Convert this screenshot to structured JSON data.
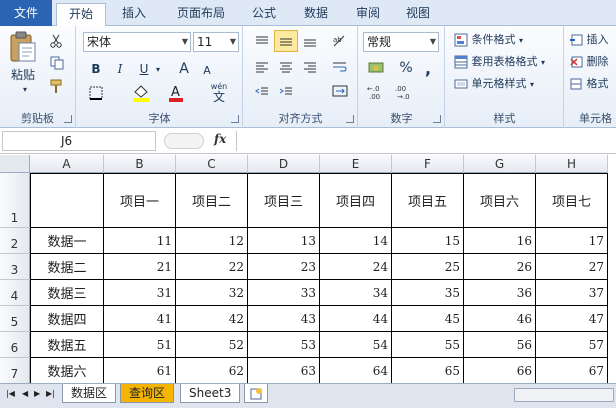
{
  "ribbon_tabs": [
    "文件",
    "开始",
    "插入",
    "页面布局",
    "公式",
    "数据",
    "审阅",
    "视图"
  ],
  "active_tab": "开始",
  "groups": {
    "clipboard": {
      "label": "剪贴板",
      "paste": "粘贴"
    },
    "font": {
      "label": "字体",
      "name": "宋体",
      "size": "11",
      "bold": "B",
      "italic": "I",
      "underline": "U",
      "grow": "A",
      "shrink": "A",
      "wen": "wén",
      "wen_char": "文"
    },
    "alignment": {
      "label": "对齐方式"
    },
    "number": {
      "label": "数字",
      "format": "常规",
      "percent": "%",
      "comma": ","
    },
    "styles": {
      "label": "样式",
      "cond": "条件格式",
      "table": "套用表格格式",
      "cell": "单元格样式"
    },
    "cells": {
      "label": "单元格",
      "insert": "插入",
      "delete": "删除",
      "format": "格式"
    }
  },
  "formula_bar": {
    "name_box": "J6",
    "fx": "fx",
    "formula": ""
  },
  "columns": [
    "A",
    "B",
    "C",
    "D",
    "E",
    "F",
    "G",
    "H"
  ],
  "rows": [
    "1",
    "2",
    "3",
    "4",
    "5",
    "6",
    "7"
  ],
  "table": {
    "headers": [
      "项目一",
      "项目二",
      "项目三",
      "项目四",
      "项目五",
      "项目六",
      "项目七"
    ],
    "data": [
      {
        "label": "数据一",
        "values": [
          "11",
          "12",
          "13",
          "14",
          "15",
          "16",
          "17"
        ]
      },
      {
        "label": "数据二",
        "values": [
          "21",
          "22",
          "23",
          "24",
          "25",
          "26",
          "27"
        ]
      },
      {
        "label": "数据三",
        "values": [
          "31",
          "32",
          "33",
          "34",
          "35",
          "36",
          "37"
        ]
      },
      {
        "label": "数据四",
        "values": [
          "41",
          "42",
          "43",
          "44",
          "45",
          "46",
          "47"
        ]
      },
      {
        "label": "数据五",
        "values": [
          "51",
          "52",
          "53",
          "54",
          "55",
          "56",
          "57"
        ]
      },
      {
        "label": "数据六",
        "values": [
          "61",
          "62",
          "63",
          "64",
          "65",
          "66",
          "67"
        ]
      }
    ]
  },
  "sheet_tabs": [
    "数据区",
    "查询区",
    "Sheet3"
  ],
  "active_sheet": "查询区",
  "colors": {
    "file_tab": "#2a64b2",
    "query_tab": "#f4b400",
    "ribbon_bg": "#dfe9f5"
  }
}
